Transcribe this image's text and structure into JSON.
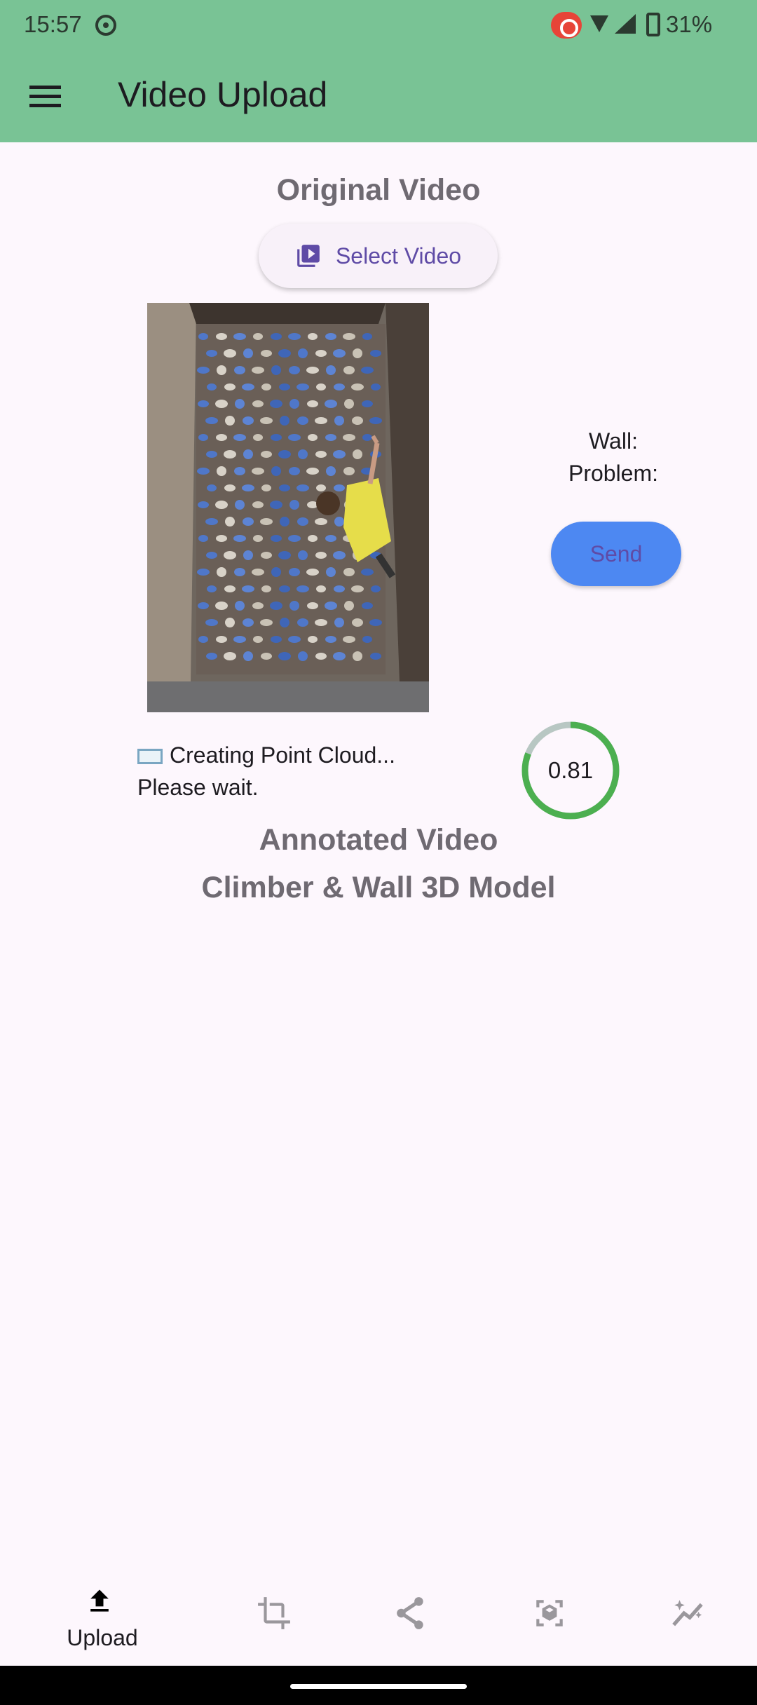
{
  "status_bar": {
    "time": "15:57",
    "battery": "31%"
  },
  "app_bar": {
    "title": "Video Upload"
  },
  "original_section": {
    "title": "Original Video",
    "select_button_label": "Select Video"
  },
  "wall_info": {
    "wall_label": "Wall:",
    "problem_label": "Problem:"
  },
  "send_button": {
    "label": "Send"
  },
  "status": {
    "line1": "Creating Point Cloud...",
    "line2": "Please wait.",
    "progress": 0.81,
    "progress_label": "0.81"
  },
  "results": {
    "annotated_title": "Annotated Video",
    "model_title": "Climber & Wall 3D Model"
  },
  "bottom_nav": {
    "items": [
      {
        "label": "Upload",
        "icon": "upload-icon",
        "active": true
      },
      {
        "label": "",
        "icon": "crop-icon",
        "active": false
      },
      {
        "label": "",
        "icon": "share-nodes-icon",
        "active": false
      },
      {
        "label": "",
        "icon": "3d-cube-icon",
        "active": false
      },
      {
        "label": "",
        "icon": "analytics-icon",
        "active": false
      }
    ]
  },
  "colors": {
    "app_bar": "#79c395",
    "accent": "#5f4ba6",
    "send": "#4d88f2",
    "progress": "#4caf50",
    "progress_track": "#b8c7c3"
  }
}
